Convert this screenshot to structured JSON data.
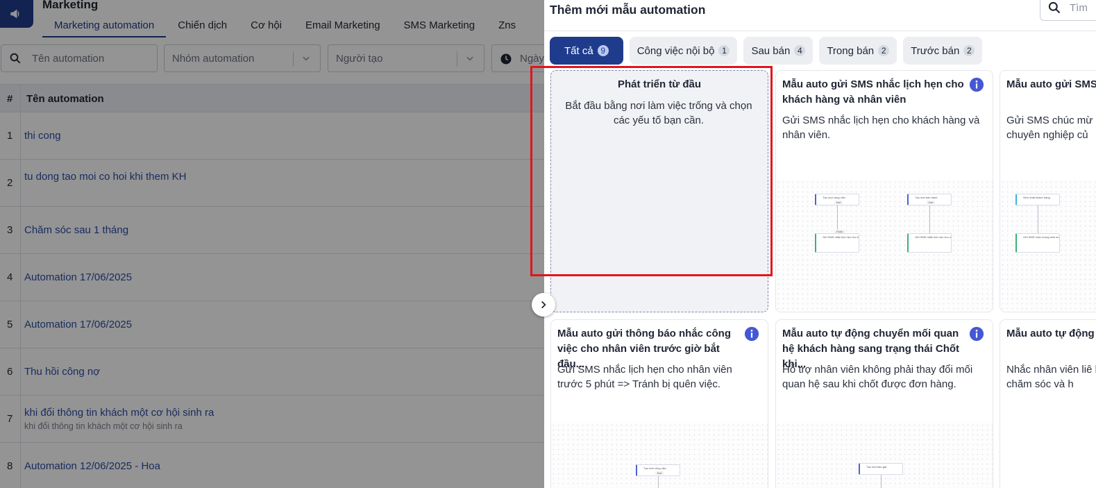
{
  "app": {
    "title": "Marketing",
    "tabs": [
      {
        "label": "Marketing automation",
        "active": true
      },
      {
        "label": "Chiến dịch"
      },
      {
        "label": "Cơ hội"
      },
      {
        "label": "Email Marketing"
      },
      {
        "label": "SMS Marketing"
      },
      {
        "label": "Zns"
      }
    ]
  },
  "filters": {
    "name_placeholder": "Tên automation",
    "group_placeholder": "Nhóm automation",
    "creator_placeholder": "Người tạo",
    "date_placeholder": "Ngày"
  },
  "table": {
    "headers": [
      "#",
      "Tên automation"
    ],
    "rows": [
      {
        "num": "1",
        "name": "thi cong",
        "sub": ""
      },
      {
        "num": "2",
        "name": "tu dong tao moi co hoi khi them KH",
        "sub": ""
      },
      {
        "num": "3",
        "name": "Chăm sóc sau 1 tháng",
        "sub": ""
      },
      {
        "num": "4",
        "name": "Automation 17/06/2025",
        "sub": ""
      },
      {
        "num": "5",
        "name": "Automation 17/06/2025",
        "sub": ""
      },
      {
        "num": "6",
        "name": "Thu hồi công nợ",
        "sub": ""
      },
      {
        "num": "7",
        "name": "khi đổi thông tin khách một cơ hội sinh ra",
        "sub": "khi đổi thông tin khách một cơ hội sinh ra"
      },
      {
        "num": "8",
        "name": "Automation 12/06/2025 - Hoa",
        "sub": ""
      }
    ]
  },
  "drawer": {
    "title": "Thêm mới mẫu automation",
    "search_placeholder": "Tìm",
    "categories": [
      {
        "label": "Tất cả",
        "count": "9",
        "active": true
      },
      {
        "label": "Công việc nội bộ",
        "count": "1"
      },
      {
        "label": "Sau bán",
        "count": "4"
      },
      {
        "label": "Trong bán",
        "count": "2"
      },
      {
        "label": "Trước bán",
        "count": "2"
      }
    ],
    "cards": [
      {
        "title": "Phát triển từ đầu",
        "desc": "Bắt đầu bằng nơi làm việc trống và chọn các yếu tố bạn cần."
      },
      {
        "title": "Mẫu auto gửi SMS nhắc lịch hẹn cho khách hàng và nhân viên",
        "desc": "Gửi SMS nhắc lịch hẹn cho khách hàng và nhân viên."
      },
      {
        "title": "Mẫu auto gửi SMS nhật Khách hàng",
        "desc": "Gửi SMS chúc mừ nhân viên => Tăng chuyên nghiệp củ"
      },
      {
        "title": "Mẫu auto gửi thông báo nhắc công việc cho nhân viên trước giờ bắt đầu...",
        "desc": "Gửi SMS nhắc lịch hẹn cho nhân viên trước 5 phút => Tránh bị quên việc."
      },
      {
        "title": "Mẫu auto tự động chuyển mối quan hệ khách hàng sang trạng thái Chốt khi...",
        "desc": "Hỗ trợ nhân viên không phải thay đổi mối quan hệ sau khi chốt được đơn hàng."
      },
      {
        "title": "Mẫu auto tự động nhân viên với các",
        "desc": "Nhắc nhân viên liê hàng như đại lý, C để chăm sóc và h"
      }
    ],
    "preview_text": {
      "create_task": "Tạo mới công việc",
      "create_warranty": "Tạo mới bảo hành",
      "send_sms_customer": "Gửi SMS nhắc lịch hẹn cho khách hàng trước 2h",
      "send_sms_staff": "Gửi SMS nhắc lịch hẹn cho nhân viên trước 1h",
      "wait": "Đợi",
      "or": "Hoặc",
      "quote": "Tạo mới báo giá",
      "birthday": "Sinh nhật khách hàng",
      "sms_birthday": "Gửi SMS chúc mừng sinh nhật khách hàng"
    }
  },
  "colors": {
    "primary": "#1f3b8c",
    "link": "#2c4da3",
    "highlight": "#e0161b",
    "info": "#4558d3"
  }
}
